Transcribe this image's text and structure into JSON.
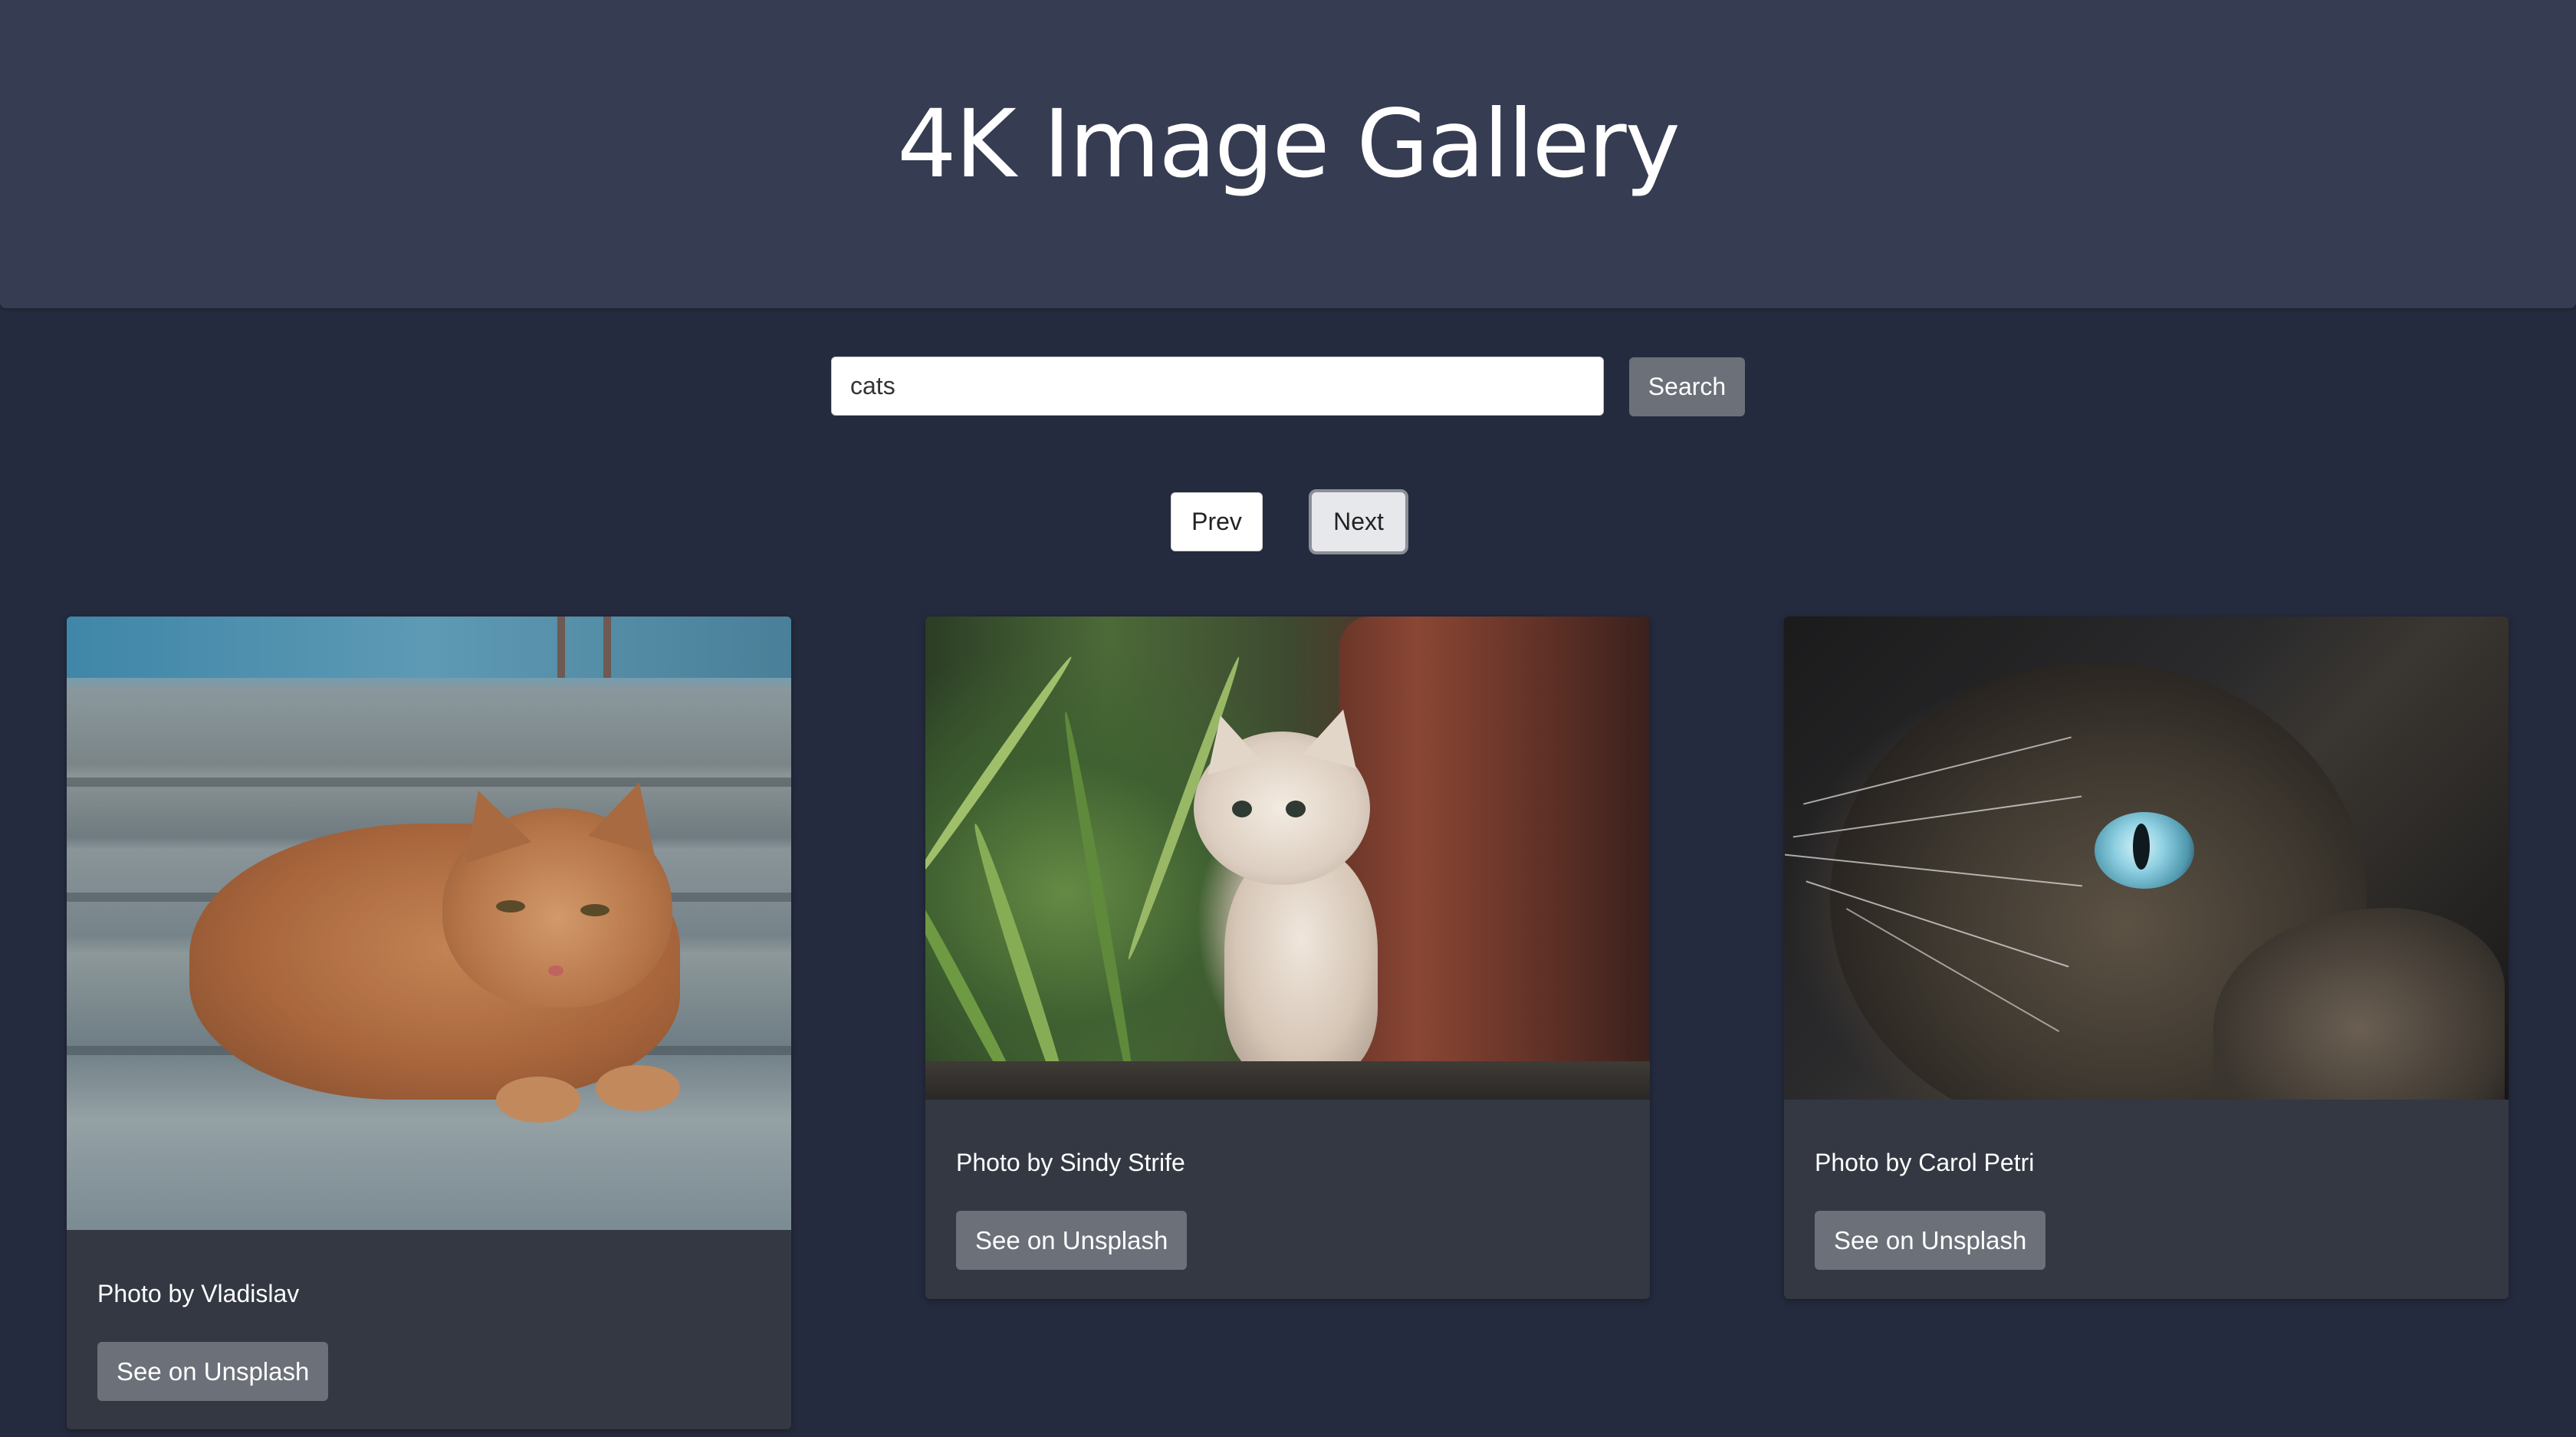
{
  "header": {
    "title": "4K Image Gallery"
  },
  "search": {
    "value": "cats",
    "button_label": "Search"
  },
  "pagination": {
    "prev_label": "Prev",
    "next_label": "Next"
  },
  "cards": [
    {
      "caption": "Photo by Vladislav",
      "button_label": "See on Unsplash",
      "image_alt": "orange tabby cat lying on steps"
    },
    {
      "caption": "Photo by Sindy Strife",
      "button_label": "See on Unsplash",
      "image_alt": "white kitten among plants beside a pot"
    },
    {
      "caption": "Photo by Carol Petri",
      "button_label": "See on Unsplash",
      "image_alt": "siamese cat with blue eyes looking up"
    }
  ],
  "colors": {
    "page_bg": "#252b3e",
    "header_bg": "#363c51",
    "card_bg": "#333843",
    "button_gray": "#6b7079"
  }
}
